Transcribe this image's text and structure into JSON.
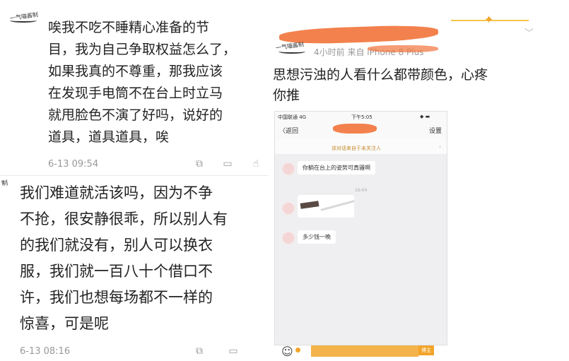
{
  "left": {
    "comment1": {
      "avatar_text": "一气喵酱制",
      "lines": [
        "唉我不吃不睡精心准备的节",
        "目，我为自己争取权益怎么了，",
        "如果我真的不尊重，那我应该",
        "在发现手电筒不在台上时立马",
        "就甩脸色不演了好吗，说好的",
        "道具，道具道具，唉"
      ],
      "time": "6-13 09:54"
    },
    "comment2": {
      "avatar_text": "制",
      "lines": [
        "我们难道就活该吗，因为不争",
        "不抢，很安静很乖，所以别人有",
        "的我们就没有，别人可以换衣",
        "服，我们就一百八十个借口不",
        "许，我们也想每场都不一样的",
        "惊喜，可是呢"
      ],
      "time": "6-13 08:16"
    }
  },
  "right": {
    "avatar_text": "一气喵酱制",
    "time_source": "4小时前   来自 iPhone 8 Plus",
    "post_lines": [
      "思想污浊的人看什么都带颜色，心疼",
      "你推"
    ],
    "phone": {
      "status_left": "中国联通 4G",
      "status_time": "下午5:05",
      "back_label": "〈返回",
      "settings_label": "设置",
      "notice": "该对话来自于未关注人",
      "msg1": "你躺在台上的姿势可真骚啊",
      "time_divider": "16:04",
      "msg3": "多少钱一晚"
    },
    "footer_badge": "博主"
  },
  "colors": {
    "accent_orange": "#f2733a",
    "meta_gray": "#999999",
    "text": "#222222"
  }
}
